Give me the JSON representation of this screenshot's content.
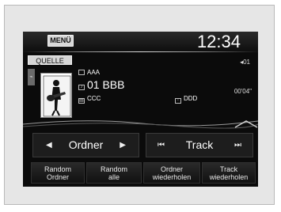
{
  "header": {
    "menu_label": "MENÜ",
    "clock": "12:34"
  },
  "source": {
    "label": "QUELLE",
    "track_number": "01"
  },
  "now_playing": {
    "artist": "AAA",
    "song": "01 BBB",
    "album": "CCC",
    "genre": "DDD",
    "elapsed": "00'04\""
  },
  "nav": {
    "folder": {
      "label": "Ordner"
    },
    "track": {
      "label": "Track"
    }
  },
  "options": [
    {
      "line1": "Random",
      "line2": "Ordner"
    },
    {
      "line1": "Random",
      "line2": "alle"
    },
    {
      "line1": "Ordner",
      "line2": "wiederholen"
    },
    {
      "line1": "Track",
      "line2": "wiederholen"
    }
  ],
  "colors": {
    "screen_bg": "#0b0b0b",
    "frame_bg": "#e6e6e6",
    "text": "#ffffff"
  },
  "icons": [
    "usb-icon",
    "artist-icon",
    "song-icon",
    "album-icon",
    "genre-icon",
    "volume-icon",
    "prev-folder-icon",
    "next-folder-icon",
    "skip-back-icon",
    "skip-forward-icon"
  ]
}
